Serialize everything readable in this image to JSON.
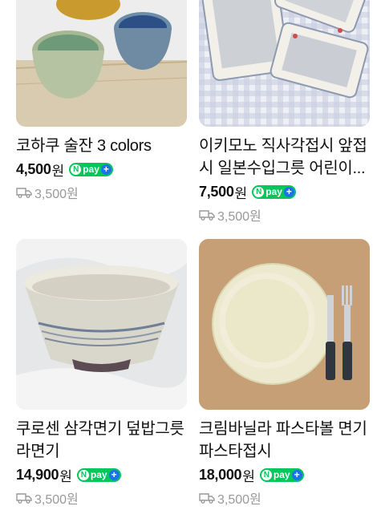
{
  "products": [
    {
      "title": "코하쿠 술잔 3 colors",
      "price": "4,500",
      "currency": "원",
      "pay_badge": "pay",
      "shipping": "3,500원"
    },
    {
      "title": "이키모노 직사각접시 앞접시 일본수입그릇 어린이...",
      "price": "7,500",
      "currency": "원",
      "pay_badge": "pay",
      "shipping": "3,500원"
    },
    {
      "title": "쿠로센 삼각면기 덮밥그릇 라면기",
      "price": "14,900",
      "currency": "원",
      "pay_badge": "pay",
      "shipping": "3,500원"
    },
    {
      "title": "크림바닐라 파스타볼 면기 파스타접시",
      "price": "18,000",
      "currency": "원",
      "pay_badge": "pay",
      "shipping": "3,500원"
    }
  ],
  "colors": {
    "npay_green": "#03c75a",
    "plus_blue": "#1a73e8",
    "muted": "#999999"
  }
}
